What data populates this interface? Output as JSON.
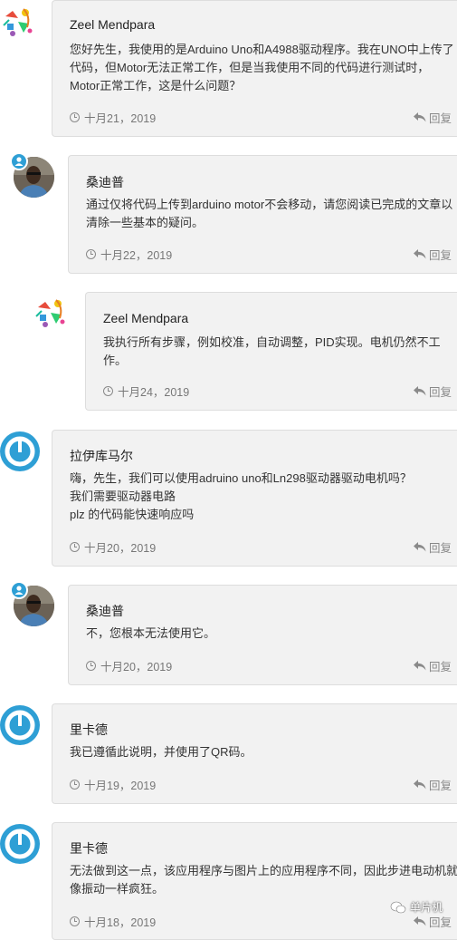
{
  "comments": [
    {
      "author": "Zeel Mendpara",
      "avatar": "colorful-doodle-avatar",
      "lines": [
        "您好先生，我使用的是Arduino Uno和A4988驱动程序。我在UNO中上传了",
        "代码，但Motor无法正常工作，但是当我使用不同的代码进行测试时，",
        "Motor正常工作，这是什么问题？"
      ],
      "date": "十月21，2019",
      "reply": "回复"
    },
    {
      "author": "桑迪普",
      "avatar": "person-photo-avatar",
      "lines": [
        "通过仅将代码上传到arduino motor不会移动，请您阅读已完成的文章以",
        "清除一些基本的疑问。"
      ],
      "date": "十月22，2019",
      "reply": "回复"
    },
    {
      "author": "Zeel Mendpara",
      "avatar": "colorful-doodle-avatar",
      "lines": [
        "我执行所有步骤，例如校准，自动调整，PID实现。电机仍然不工",
        "作。"
      ],
      "date": "十月24，2019",
      "reply": "回复"
    },
    {
      "author": "拉伊库马尔",
      "avatar": "disqus-default-avatar",
      "lines": [
        "嗨，先生，我们可以使用adruino uno和Ln298驱动器驱动电机吗？",
        "我们需要驱动器电路",
        "plz 的代码能快速响应吗"
      ],
      "date": "十月20，2019",
      "reply": "回复"
    },
    {
      "author": "桑迪普",
      "avatar": "person-photo-avatar",
      "lines": [
        "不，您根本无法使用它。"
      ],
      "date": "十月20，2019",
      "reply": "回复"
    },
    {
      "author": "里卡德",
      "avatar": "disqus-default-avatar",
      "lines": [
        "我已遵循此说明，并使用了QR码。"
      ],
      "date": "十月19，2019",
      "reply": "回复"
    },
    {
      "author": "里卡德",
      "avatar": "disqus-default-avatar",
      "lines": [
        "无法做到这一点，该应用程序与图片上的应用程序不同，因此步进电动机就",
        "像振动一样疯狂。"
      ],
      "date": "十月18，2019",
      "reply": "回复"
    }
  ],
  "watermark": "单片机",
  "colors": {
    "card_bg": "#f2f2f2",
    "card_border": "#dddddd",
    "disqus_blue": "#2e9fd5",
    "meta_gray": "#777777"
  }
}
